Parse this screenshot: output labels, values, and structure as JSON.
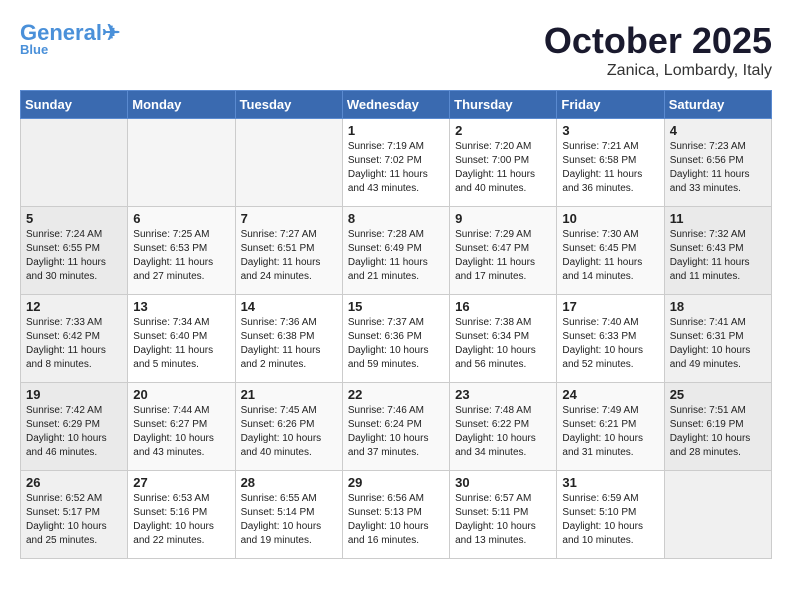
{
  "header": {
    "logo_general": "General",
    "logo_blue": "Blue",
    "month": "October 2025",
    "location": "Zanica, Lombardy, Italy"
  },
  "weekdays": [
    "Sunday",
    "Monday",
    "Tuesday",
    "Wednesday",
    "Thursday",
    "Friday",
    "Saturday"
  ],
  "weeks": [
    [
      {
        "day": "",
        "info": ""
      },
      {
        "day": "",
        "info": ""
      },
      {
        "day": "",
        "info": ""
      },
      {
        "day": "1",
        "info": "Sunrise: 7:19 AM\nSunset: 7:02 PM\nDaylight: 11 hours\nand 43 minutes."
      },
      {
        "day": "2",
        "info": "Sunrise: 7:20 AM\nSunset: 7:00 PM\nDaylight: 11 hours\nand 40 minutes."
      },
      {
        "day": "3",
        "info": "Sunrise: 7:21 AM\nSunset: 6:58 PM\nDaylight: 11 hours\nand 36 minutes."
      },
      {
        "day": "4",
        "info": "Sunrise: 7:23 AM\nSunset: 6:56 PM\nDaylight: 11 hours\nand 33 minutes."
      }
    ],
    [
      {
        "day": "5",
        "info": "Sunrise: 7:24 AM\nSunset: 6:55 PM\nDaylight: 11 hours\nand 30 minutes."
      },
      {
        "day": "6",
        "info": "Sunrise: 7:25 AM\nSunset: 6:53 PM\nDaylight: 11 hours\nand 27 minutes."
      },
      {
        "day": "7",
        "info": "Sunrise: 7:27 AM\nSunset: 6:51 PM\nDaylight: 11 hours\nand 24 minutes."
      },
      {
        "day": "8",
        "info": "Sunrise: 7:28 AM\nSunset: 6:49 PM\nDaylight: 11 hours\nand 21 minutes."
      },
      {
        "day": "9",
        "info": "Sunrise: 7:29 AM\nSunset: 6:47 PM\nDaylight: 11 hours\nand 17 minutes."
      },
      {
        "day": "10",
        "info": "Sunrise: 7:30 AM\nSunset: 6:45 PM\nDaylight: 11 hours\nand 14 minutes."
      },
      {
        "day": "11",
        "info": "Sunrise: 7:32 AM\nSunset: 6:43 PM\nDaylight: 11 hours\nand 11 minutes."
      }
    ],
    [
      {
        "day": "12",
        "info": "Sunrise: 7:33 AM\nSunset: 6:42 PM\nDaylight: 11 hours\nand 8 minutes."
      },
      {
        "day": "13",
        "info": "Sunrise: 7:34 AM\nSunset: 6:40 PM\nDaylight: 11 hours\nand 5 minutes."
      },
      {
        "day": "14",
        "info": "Sunrise: 7:36 AM\nSunset: 6:38 PM\nDaylight: 11 hours\nand 2 minutes."
      },
      {
        "day": "15",
        "info": "Sunrise: 7:37 AM\nSunset: 6:36 PM\nDaylight: 10 hours\nand 59 minutes."
      },
      {
        "day": "16",
        "info": "Sunrise: 7:38 AM\nSunset: 6:34 PM\nDaylight: 10 hours\nand 56 minutes."
      },
      {
        "day": "17",
        "info": "Sunrise: 7:40 AM\nSunset: 6:33 PM\nDaylight: 10 hours\nand 52 minutes."
      },
      {
        "day": "18",
        "info": "Sunrise: 7:41 AM\nSunset: 6:31 PM\nDaylight: 10 hours\nand 49 minutes."
      }
    ],
    [
      {
        "day": "19",
        "info": "Sunrise: 7:42 AM\nSunset: 6:29 PM\nDaylight: 10 hours\nand 46 minutes."
      },
      {
        "day": "20",
        "info": "Sunrise: 7:44 AM\nSunset: 6:27 PM\nDaylight: 10 hours\nand 43 minutes."
      },
      {
        "day": "21",
        "info": "Sunrise: 7:45 AM\nSunset: 6:26 PM\nDaylight: 10 hours\nand 40 minutes."
      },
      {
        "day": "22",
        "info": "Sunrise: 7:46 AM\nSunset: 6:24 PM\nDaylight: 10 hours\nand 37 minutes."
      },
      {
        "day": "23",
        "info": "Sunrise: 7:48 AM\nSunset: 6:22 PM\nDaylight: 10 hours\nand 34 minutes."
      },
      {
        "day": "24",
        "info": "Sunrise: 7:49 AM\nSunset: 6:21 PM\nDaylight: 10 hours\nand 31 minutes."
      },
      {
        "day": "25",
        "info": "Sunrise: 7:51 AM\nSunset: 6:19 PM\nDaylight: 10 hours\nand 28 minutes."
      }
    ],
    [
      {
        "day": "26",
        "info": "Sunrise: 6:52 AM\nSunset: 5:17 PM\nDaylight: 10 hours\nand 25 minutes."
      },
      {
        "day": "27",
        "info": "Sunrise: 6:53 AM\nSunset: 5:16 PM\nDaylight: 10 hours\nand 22 minutes."
      },
      {
        "day": "28",
        "info": "Sunrise: 6:55 AM\nSunset: 5:14 PM\nDaylight: 10 hours\nand 19 minutes."
      },
      {
        "day": "29",
        "info": "Sunrise: 6:56 AM\nSunset: 5:13 PM\nDaylight: 10 hours\nand 16 minutes."
      },
      {
        "day": "30",
        "info": "Sunrise: 6:57 AM\nSunset: 5:11 PM\nDaylight: 10 hours\nand 13 minutes."
      },
      {
        "day": "31",
        "info": "Sunrise: 6:59 AM\nSunset: 5:10 PM\nDaylight: 10 hours\nand 10 minutes."
      },
      {
        "day": "",
        "info": ""
      }
    ]
  ]
}
